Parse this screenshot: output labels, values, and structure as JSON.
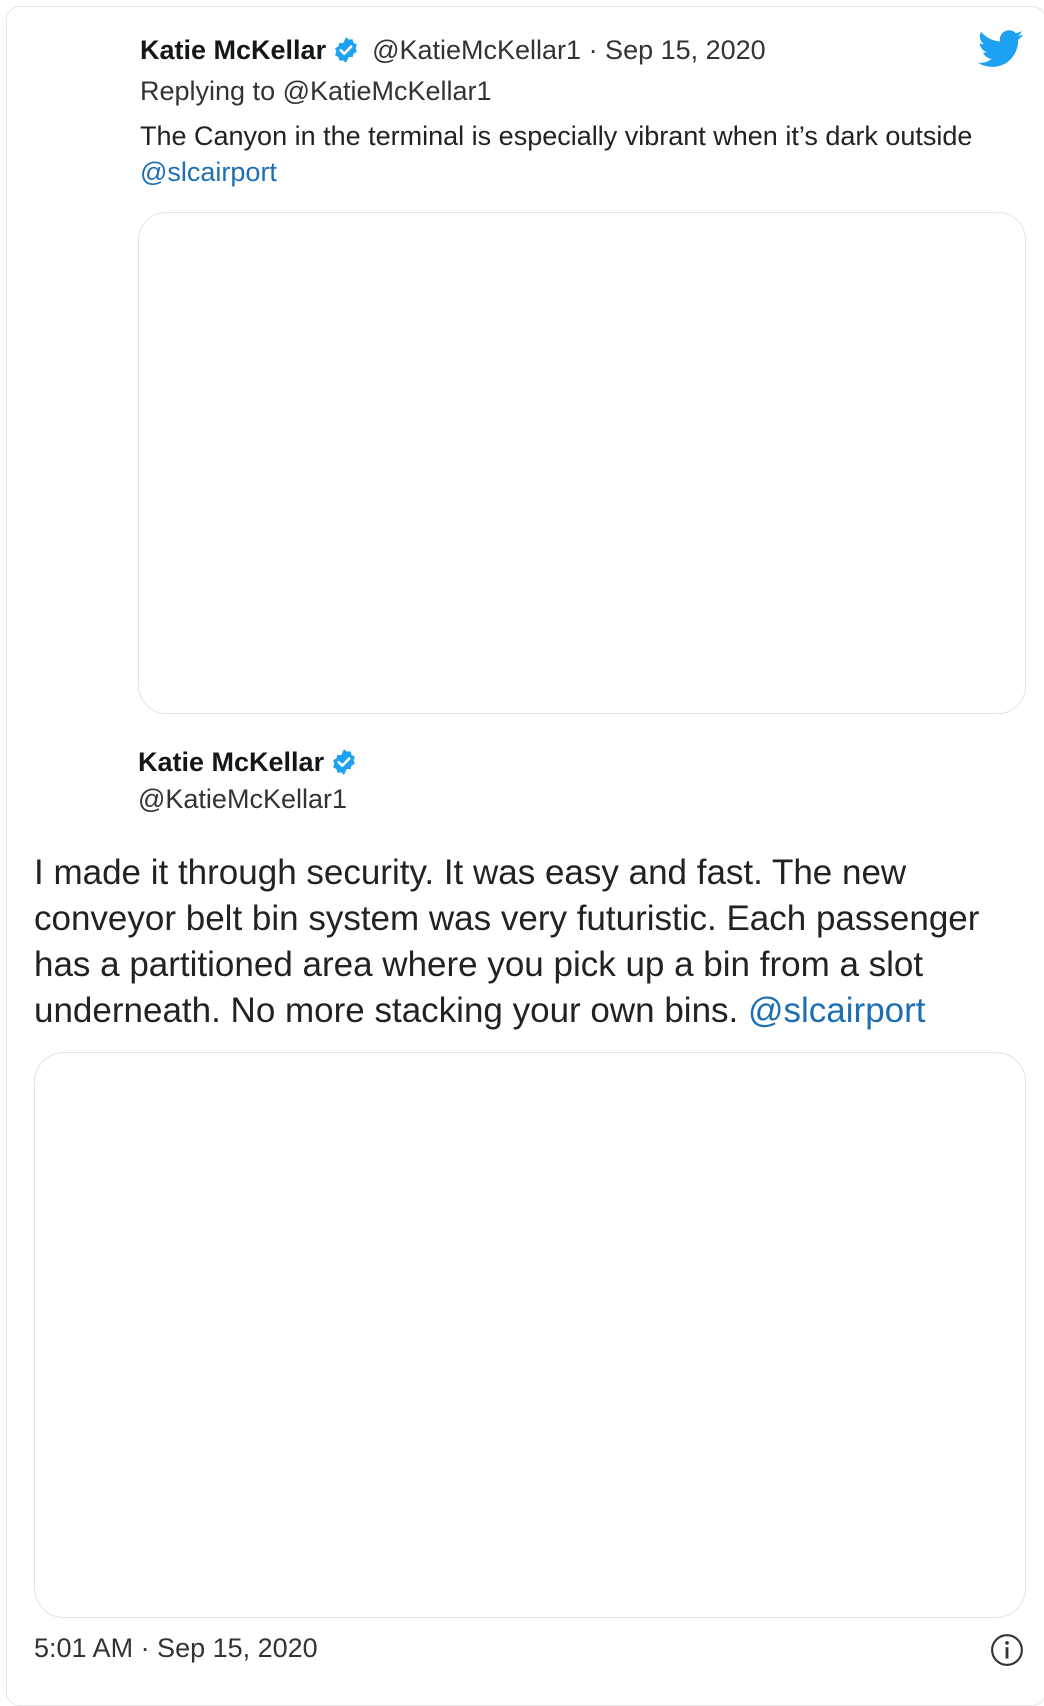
{
  "colors": {
    "twitter_blue": "#1da1f2",
    "mention_blue": "#1d6fb3",
    "text": "#222222"
  },
  "reply_tweet": {
    "author_name": "Katie McKellar",
    "verified_icon": "verified-badge-icon",
    "handle_date": "@KatieMcKellar1 · Sep 15, 2020",
    "replying_to": "Replying to @KatieMcKellar1",
    "text": "The Canyon in the terminal is especially vibrant when it’s dark outside ",
    "mention": "@slcairport"
  },
  "main_tweet": {
    "author_name": "Katie McKellar",
    "verified_icon": "verified-badge-icon",
    "handle": "@KatieMcKellar1",
    "text": "I made it through security. It was easy and fast. The new conveyor belt  bin system was very futuristic. Each passenger has a partitioned area where you pick up a bin from a slot underneath. No more stacking your own bins. ",
    "mention": "@slcairport",
    "timestamp": "5:01 AM · Sep 15, 2020"
  },
  "icons": {
    "logo": "twitter-bird-icon",
    "info": "info-icon"
  }
}
